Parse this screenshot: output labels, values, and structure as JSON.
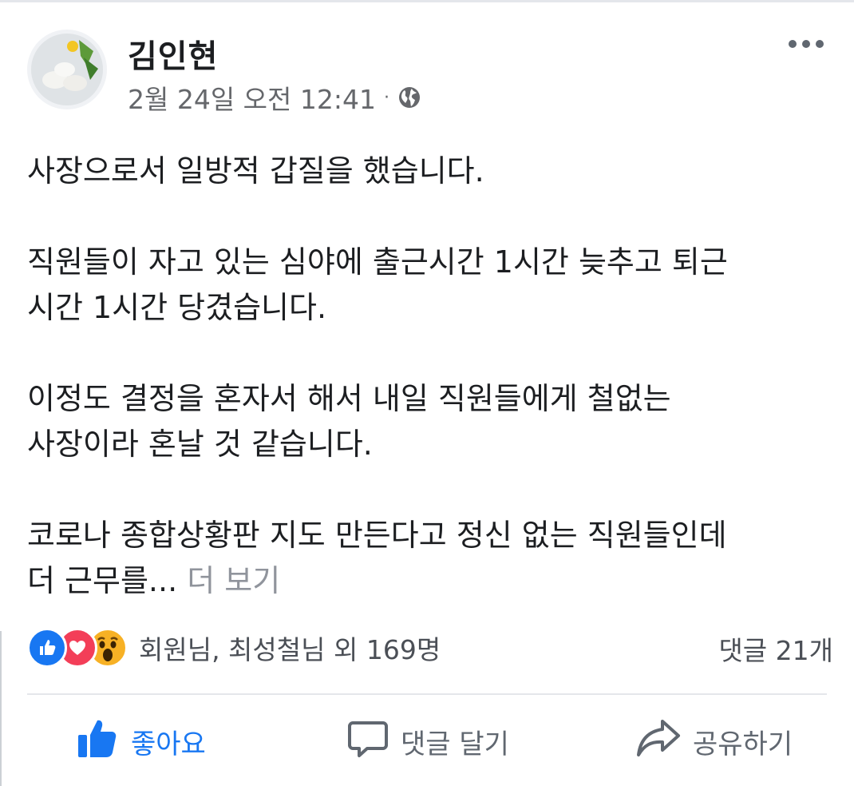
{
  "post": {
    "author": "김인현",
    "timestamp": "2월 24일 오전 12:41",
    "separator": "·",
    "privacy_icon": "globe-icon",
    "paragraphs": [
      "사장으로서 일방적 갑질을 했습니다.",
      "직원들이 자고 있는 심야에 출근시간 1시간 늦추고 퇴근\n시간 1시간 당겼습니다.",
      "이정도 결정을 혼자서 해서 내일 직원들에게 철없는\n사장이라 혼날 것 같습니다."
    ],
    "last_paragraph": "코로나 종합상황판 지도 만든다고 정신 없는 직원들인데\n더 근무를...",
    "see_more": " 더 보기"
  },
  "reactions": {
    "icons": [
      "like-reaction-icon",
      "love-reaction-icon",
      "wow-reaction-icon"
    ],
    "summary": "회원님, 최성철님 외 169명"
  },
  "comments": {
    "count_label": "댓글 21개"
  },
  "actions": {
    "like_label": "좋아요",
    "comment_label": "댓글 달기",
    "share_label": "공유하기"
  },
  "colors": {
    "accent": "#1877f2",
    "secondary_text": "#65676b",
    "love": "#f33e58",
    "wow": "#f7b125"
  }
}
